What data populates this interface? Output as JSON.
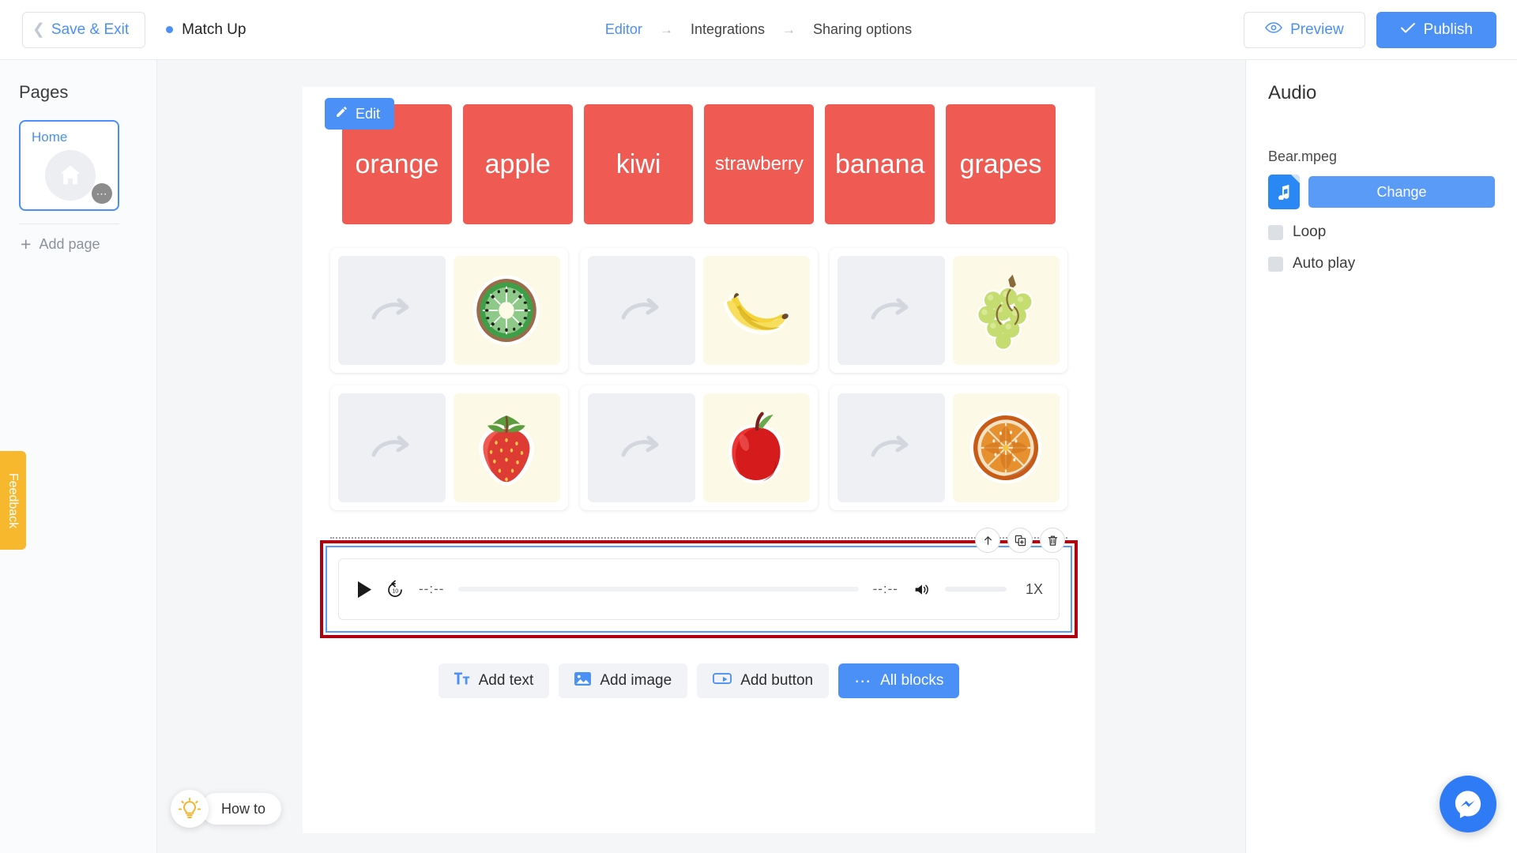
{
  "topbar": {
    "save_exit_label": "Save & Exit",
    "back_chevron_icon": "chevron-left-icon",
    "project_title": "Match Up",
    "breadcrumb": [
      {
        "label": "Editor",
        "active": true
      },
      {
        "label": "Integrations",
        "active": false
      },
      {
        "label": "Sharing options",
        "active": false
      }
    ],
    "breadcrumb_arrow": "→",
    "preview_label": "Preview",
    "preview_icon": "eye-icon",
    "publish_label": "Publish",
    "publish_icon": "check-icon",
    "accent_blue": "#4a90f7"
  },
  "sidebar": {
    "title": "Pages",
    "pages": [
      {
        "name": "Home",
        "icon": "home-icon",
        "selected": true,
        "menu_icon": "more-dots-icon"
      }
    ],
    "add_page_label": "Add page",
    "add_page_icon": "plus-icon",
    "feedback_label": "Feedback",
    "feedback_color": "#f7b82e",
    "howto_label": "How to",
    "howto_icon": "lightbulb-icon"
  },
  "canvas": {
    "words_block": {
      "edit_label": "Edit",
      "edit_icon": "pencil-icon",
      "card_color": "#ef5a53",
      "cards": [
        {
          "label": "orange",
          "small": false
        },
        {
          "label": "apple",
          "small": false
        },
        {
          "label": "kiwi",
          "small": false
        },
        {
          "label": "strawberry",
          "small": true
        },
        {
          "label": "banana",
          "small": false
        },
        {
          "label": "grapes",
          "small": false
        }
      ]
    },
    "pairs": {
      "drop_icon": "curved-arrow-icon",
      "rows": [
        [
          {
            "image": "kiwi-image",
            "image_name": "kiwi"
          },
          {
            "image": "banana-image",
            "image_name": "banana"
          },
          {
            "image": "grapes-image",
            "image_name": "grapes"
          }
        ],
        [
          {
            "image": "strawberry-image",
            "image_name": "strawberry"
          },
          {
            "image": "apple-image",
            "image_name": "apple"
          },
          {
            "image": "orange-image",
            "image_name": "orange"
          }
        ]
      ]
    },
    "audio_block": {
      "selected": true,
      "selection_color": "#b00010",
      "play_icon": "play-icon",
      "rewind_icon": "rewind-10-icon",
      "current_time": "--:--",
      "duration": "--:--",
      "volume_icon": "volume-icon",
      "speed_label": "1X",
      "tools": [
        {
          "icon": "move-up-icon",
          "name": "move-up-button"
        },
        {
          "icon": "duplicate-icon",
          "name": "duplicate-button"
        },
        {
          "icon": "trash-icon",
          "name": "delete-button"
        }
      ]
    },
    "addbar": [
      {
        "label": "Add text",
        "icon": "text-icon",
        "primary": false
      },
      {
        "label": "Add image",
        "icon": "image-icon",
        "primary": false
      },
      {
        "label": "Add button",
        "icon": "button-icon",
        "primary": false
      },
      {
        "label": "All blocks",
        "icon": "more-dots-icon",
        "primary": true
      }
    ]
  },
  "rightpanel": {
    "title": "Audio",
    "file_name": "Bear.mpeg",
    "file_icon": "music-note-icon",
    "change_label": "Change",
    "options": [
      {
        "label": "Loop",
        "checked": false
      },
      {
        "label": "Auto play",
        "checked": false
      }
    ]
  },
  "messenger": {
    "icon": "messenger-icon",
    "color": "#2f7bf6"
  }
}
